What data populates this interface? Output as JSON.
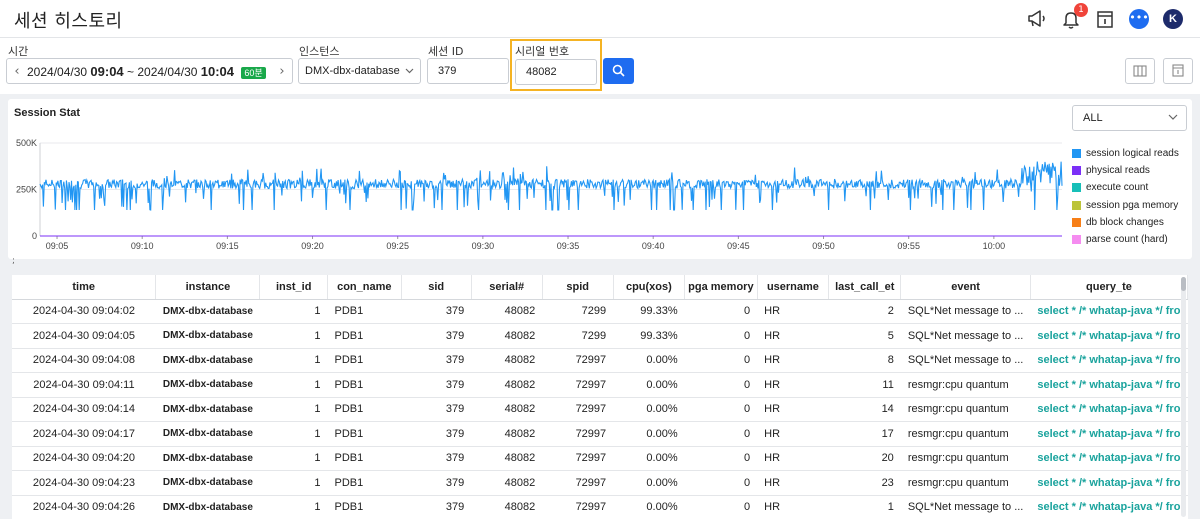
{
  "page": {
    "title": "세션 히스토리"
  },
  "header": {
    "notification_count": "1",
    "avatar_letter": "K",
    "chat_glyph": "•••",
    "icons": [
      "megaphone-icon",
      "bell-icon",
      "document-icon",
      "chat-icon"
    ]
  },
  "filters": {
    "time_label": "시간",
    "time_from_date": "2024/04/30",
    "time_from_hm": "09:04",
    "time_sep": "~",
    "time_to_date": "2024/04/30",
    "time_to_hm": "10:04",
    "time_duration": "60분",
    "instance_label": "인스턴스",
    "instance_value": "DMX-dbx-database",
    "sid_label": "세션 ID",
    "sid_value": "379",
    "serial_label": "시리얼 번호",
    "serial_value": "48082"
  },
  "chart_panel": {
    "title": "Session Stat",
    "selector_value": "ALL",
    "footnote": ";"
  },
  "colors": {
    "accent": "#1e6cf0",
    "highlight": "#f5b323",
    "query": "#1aa39d",
    "duration": "#19a84a"
  },
  "chart_data": {
    "type": "line",
    "y_ticks": [
      "500K",
      "250K",
      "0"
    ],
    "ylim": [
      0,
      500000
    ],
    "x_ticks": [
      "09:05",
      "09:10",
      "09:15",
      "09:20",
      "09:25",
      "09:30",
      "09:35",
      "09:40",
      "09:45",
      "09:50",
      "09:55",
      "10:00"
    ],
    "x_range": [
      "09:04",
      "10:04"
    ],
    "grid": true,
    "legend_position": "right",
    "series": [
      {
        "name": "session logical reads",
        "color": "#2196f3",
        "typical_value": 280000,
        "min_value": 140000,
        "max_value": 400000,
        "last_value": 270000
      },
      {
        "name": "physical reads",
        "color": "#7b2ff7",
        "typical_value": 0
      },
      {
        "name": "execute count",
        "color": "#17bfb8",
        "typical_value": 0
      },
      {
        "name": "session pga memory",
        "color": "#bcc43a",
        "typical_value": 0
      },
      {
        "name": "db block changes",
        "color": "#f77f17",
        "typical_value": 0
      },
      {
        "name": "parse count (hard)",
        "color": "#f58cf0",
        "typical_value": 0
      }
    ]
  },
  "table": {
    "columns": [
      "time",
      "instance",
      "inst_id",
      "con_name",
      "sid",
      "serial#",
      "spid",
      "cpu(xos)",
      "pga memory",
      "username",
      "last_call_et",
      "event",
      "query_te"
    ],
    "rows": [
      [
        "2024-04-30 09:04:02",
        "DMX-dbx-database",
        "1",
        "PDB1",
        "379",
        "48082",
        "7299",
        "99.33%",
        "0",
        "HR",
        "2",
        "SQL*Net message to ...",
        "select * /* whatap-java */ fro"
      ],
      [
        "2024-04-30 09:04:05",
        "DMX-dbx-database",
        "1",
        "PDB1",
        "379",
        "48082",
        "7299",
        "99.33%",
        "0",
        "HR",
        "5",
        "SQL*Net message to ...",
        "select * /* whatap-java */ fro"
      ],
      [
        "2024-04-30 09:04:08",
        "DMX-dbx-database",
        "1",
        "PDB1",
        "379",
        "48082",
        "72997",
        "0.00%",
        "0",
        "HR",
        "8",
        "SQL*Net message to ...",
        "select * /* whatap-java */ fro"
      ],
      [
        "2024-04-30 09:04:11",
        "DMX-dbx-database",
        "1",
        "PDB1",
        "379",
        "48082",
        "72997",
        "0.00%",
        "0",
        "HR",
        "11",
        "resmgr:cpu quantum",
        "select * /* whatap-java */ fro"
      ],
      [
        "2024-04-30 09:04:14",
        "DMX-dbx-database",
        "1",
        "PDB1",
        "379",
        "48082",
        "72997",
        "0.00%",
        "0",
        "HR",
        "14",
        "resmgr:cpu quantum",
        "select * /* whatap-java */ fro"
      ],
      [
        "2024-04-30 09:04:17",
        "DMX-dbx-database",
        "1",
        "PDB1",
        "379",
        "48082",
        "72997",
        "0.00%",
        "0",
        "HR",
        "17",
        "resmgr:cpu quantum",
        "select * /* whatap-java */ fro"
      ],
      [
        "2024-04-30 09:04:20",
        "DMX-dbx-database",
        "1",
        "PDB1",
        "379",
        "48082",
        "72997",
        "0.00%",
        "0",
        "HR",
        "20",
        "resmgr:cpu quantum",
        "select * /* whatap-java */ fro"
      ],
      [
        "2024-04-30 09:04:23",
        "DMX-dbx-database",
        "1",
        "PDB1",
        "379",
        "48082",
        "72997",
        "0.00%",
        "0",
        "HR",
        "23",
        "resmgr:cpu quantum",
        "select * /* whatap-java */ fro"
      ],
      [
        "2024-04-30 09:04:26",
        "DMX-dbx-database",
        "1",
        "PDB1",
        "379",
        "48082",
        "72997",
        "0.00%",
        "0",
        "HR",
        "1",
        "SQL*Net message to ...",
        "select * /* whatap-java */ fro"
      ]
    ]
  }
}
